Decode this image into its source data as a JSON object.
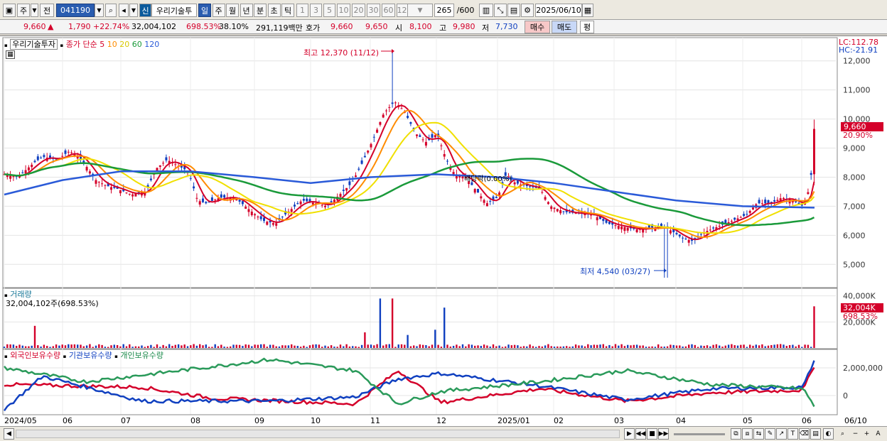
{
  "toolbar": {
    "market": "주",
    "prev": "전",
    "code": "041190",
    "badge": "신",
    "stock_name": "우리기술투",
    "periods": [
      "일",
      "주",
      "월",
      "년",
      "분",
      "초",
      "틱"
    ],
    "active_period": "일",
    "intervals": [
      "1",
      "3",
      "5",
      "10",
      "20",
      "30",
      "60",
      "120"
    ],
    "count": "265",
    "count_total": "/600",
    "date": "2025/06/10"
  },
  "quote": {
    "price": "9,660",
    "change": "1,790",
    "change_pct": "+22.74%",
    "volume": "32,004,102",
    "vol_ratio": "698.53%",
    "turnover": "38.10%",
    "amount": "291,119백만",
    "bid_label": "호가",
    "ask": "9,660",
    "bid": "9,650",
    "open_label": "시",
    "open": "8,100",
    "high_label": "고",
    "high": "9,980",
    "low_label": "저",
    "low": "7,730",
    "buy": "매수",
    "sell": "매도",
    "eval": "평"
  },
  "price_panel": {
    "title": "우리기술투자",
    "series_label": "종가 단순",
    "ma_periods": [
      "5",
      "10",
      "20",
      "60",
      "120"
    ],
    "lc": "LC:112.78",
    "hc": "HC:-21.91",
    "high_note": "최고 12,370 (11/12)",
    "low_note": "최저 4,540 (03/27)",
    "dividend_note": "배당락(0.00%)",
    "price_tag": "9,660",
    "pct_tag": "20.90%",
    "y_ticks": [
      "12,000",
      "11,000",
      "10,000",
      "9,000",
      "8,000",
      "7,000",
      "6,000",
      "5,000"
    ]
  },
  "volume_panel": {
    "title": "거래량",
    "value": "32,004,102주(698.53%)",
    "y_ticks": [
      "40,000K",
      "20,000K"
    ],
    "tag": "32,004K",
    "tag_pct": "698.53%"
  },
  "holding_panel": {
    "legends": [
      "외국인보유수량",
      "기관보유수량",
      "개인보유수량"
    ],
    "y_ticks": [
      "2,000,000",
      "0"
    ]
  },
  "x_axis": [
    "2024/05",
    "06",
    "07",
    "08",
    "09",
    "10",
    "11",
    "12",
    "2025/01",
    "02",
    "03",
    "04",
    "05",
    "06",
    "06/10"
  ],
  "colors": {
    "up": "#d4002a",
    "down": "#1040c0",
    "ma5": "#d4002a",
    "ma10": "#ff8c00",
    "ma20": "#f0e000",
    "ma60": "#1a9a3a",
    "ma120": "#2a5ad8"
  },
  "chart_data": {
    "type": "line",
    "x": [
      "2024/05",
      "06",
      "07",
      "08",
      "09",
      "10",
      "11",
      "12",
      "2025/01",
      "02",
      "03",
      "04",
      "05",
      "06"
    ],
    "series": [
      {
        "name": "종가",
        "values": [
          8000,
          8500,
          7500,
          7700,
          7000,
          7100,
          10300,
          8000,
          7700,
          6800,
          6200,
          6300,
          7200,
          9660
        ]
      },
      {
        "name": "120",
        "values": [
          7400,
          7900,
          8200,
          8200,
          8000,
          7800,
          8000,
          8100,
          8000,
          7800,
          7500,
          7200,
          7000,
          6950
        ]
      }
    ],
    "ylim": [
      4200,
      12800
    ]
  }
}
